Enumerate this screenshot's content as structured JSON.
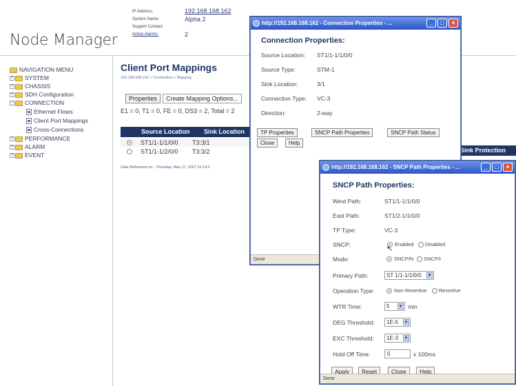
{
  "app": {
    "logo": "Node Manager",
    "header": {
      "ip_label": "IP Address:",
      "ip_value": "192.168.168.162",
      "system_label": "System Name:",
      "system_value": "Alpha 2",
      "support_label": "Support Contact:",
      "alarms_label": "Active Alarms:",
      "alarms_value": "2"
    }
  },
  "nav": {
    "root": "NAVIGATION MENU",
    "items": [
      {
        "label": "SYSTEM"
      },
      {
        "label": "CHASSIS"
      },
      {
        "label": "SDH Configuration"
      },
      {
        "label": "CONNECTION"
      },
      {
        "label": "Ethernet Flows"
      },
      {
        "label": "Client Port Mappings"
      },
      {
        "label": "Cross-Connections"
      },
      {
        "label": "PERFORMANCE"
      },
      {
        "label": "ALARM"
      },
      {
        "label": "EVENT"
      }
    ]
  },
  "main": {
    "title": "Client Port Mappings",
    "breadcrumb": "192.168.168.162 > Connection > Mapping",
    "buttons": {
      "properties": "Properties",
      "create": "Create Mapping Options..."
    },
    "counts": "E1 = 0, T1 = 0, FE = 0, DS3 = 2, Total = 2",
    "table": {
      "headers": [
        "Source Location",
        "Sink Location"
      ],
      "rows": [
        {
          "source": "ST1/1-1/1/0/0",
          "sink": "T3:3/1",
          "selected": true
        },
        {
          "source": "ST1/1-1/2/0/0",
          "sink": "T3:3/2",
          "selected": false
        }
      ]
    },
    "refreshed": "Data Refreshed on - Thursday, May 17, 2007 12:14:2",
    "extra_header": "Sink Protection"
  },
  "conn_window": {
    "title": "http://192.168.168.162 - Connection Properties - ...",
    "heading": "Connection Properties:",
    "fields": [
      {
        "label": "Source Location:",
        "value": "ST1/1-1/1/0/0"
      },
      {
        "label": "Source Type:",
        "value": "STM-1"
      },
      {
        "label": "Sink Location:",
        "value": "3/1"
      },
      {
        "label": "Connection Type:",
        "value": "VC-3"
      },
      {
        "label": "Direction:",
        "value": "2-way"
      }
    ],
    "buttons": {
      "tp": "TP Properties",
      "sncp_props": "SNCP Path Properties",
      "sncp_status": "SNCP Path Status",
      "close": "Close",
      "help": "Help"
    },
    "status": "Done"
  },
  "sncp_window": {
    "title": "http://192.168.168.162 - SNCP Path Properties - ...",
    "heading": "SNCP Path Properties:",
    "west_label": "West Path:",
    "west_value": "ST1/1-1/1/0/0",
    "east_label": "East Path:",
    "east_value": "ST1/2-1/1/0/0",
    "tp_label": "TP Type:",
    "tp_value": "VC-3",
    "sncp_label": "SNCP:",
    "sncp_enabled": "Enabled",
    "sncp_disabled": "Disabled",
    "mode_label": "Mode:",
    "mode_n": "SNCP/N",
    "mode_i": "SNCP/I",
    "primary_label": "Primary Path:",
    "primary_value": "ST 1/1-1/1/0/0",
    "optype_label": "Operation Type:",
    "optype_nonrev": "Non Revertive",
    "optype_rev": "Revertive",
    "wtr_label": "WTR Time:",
    "wtr_value": "5",
    "wtr_unit": "min",
    "deg_label": "DEG Threshold:",
    "deg_value": "1E-5",
    "exc_label": "EXC Threshold:",
    "exc_value": "1E-3",
    "hold_label": "Hold Off Time:",
    "hold_value": "0",
    "hold_unit": "x 100ms",
    "buttons": {
      "apply": "Apply",
      "reset": "Reset",
      "close": "Close",
      "help": "Help"
    },
    "status": "Done"
  }
}
